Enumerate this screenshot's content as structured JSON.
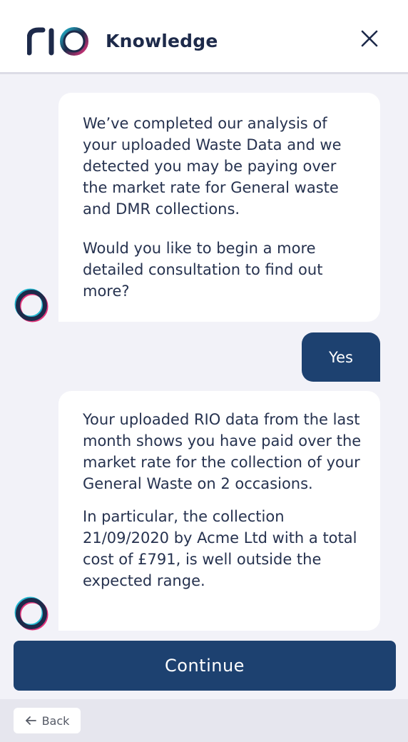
{
  "header": {
    "brand": "rio",
    "title": "Knowledge",
    "close_icon": "close-icon"
  },
  "messages": [
    {
      "from": "bot",
      "paragraphs": [
        "We’ve completed our analysis of your uploaded Waste Data and we detected you may be paying over the market rate for General waste and DMR collections.",
        "Would you like to begin a more detailed consultation to find out more?"
      ]
    },
    {
      "from": "user",
      "text": "Yes"
    },
    {
      "from": "bot",
      "paragraphs": [
        "Your uploaded RIO data from the last month shows you have paid over the market rate for the collection of your General Waste on 2 occasions.",
        "In particular, the collection 21/09/2020 by Acme Ltd with a total cost of £791, is well outside the expected range."
      ]
    }
  ],
  "actions": {
    "continue_label": "Continue"
  },
  "footer": {
    "back_label": "Back",
    "back_icon": "arrow-left-icon"
  },
  "colors": {
    "primary": "#1d4170",
    "text": "#1d2a4a",
    "background": "#f2f2f8",
    "accent_pink": "#e2337a",
    "accent_cyan": "#22b8d0"
  }
}
